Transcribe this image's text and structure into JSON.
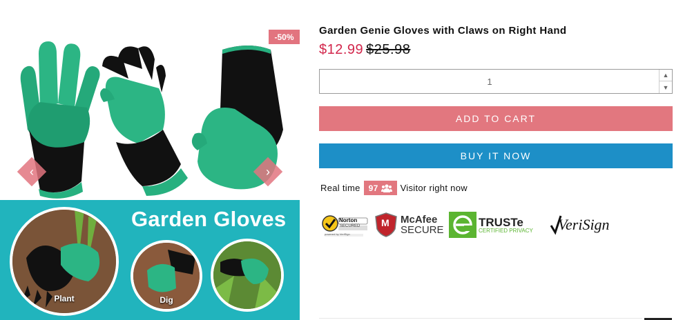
{
  "product": {
    "title": "Garden Genie Gloves with Claws on Right Hand",
    "sale_price": "$12.99",
    "compare_price": "$25.98",
    "discount_badge": "-50%"
  },
  "gallery": {
    "prev_label": "‹",
    "next_label": "›",
    "banner": {
      "title": "Garden Gloves",
      "captions": [
        "Plant",
        "Dig"
      ]
    }
  },
  "quantity": {
    "value": "1",
    "up_label": "▲",
    "down_label": "▼"
  },
  "buttons": {
    "add_to_cart": "ADD TO CART",
    "buy_now": "BUY IT NOW"
  },
  "realtime": {
    "prefix": "Real time",
    "count": "97",
    "suffix": "Visitor right now",
    "icon": "users-icon"
  },
  "trust_badges": {
    "norton": {
      "name": "Norton",
      "sub": "SECURED",
      "powered": "powered by VeriSign"
    },
    "mcafee": {
      "name": "McAfee",
      "sub": "SECURE",
      "mark": "M"
    },
    "truste": {
      "name": "TRUSTe",
      "sub": "CERTIFIED PRIVACY"
    },
    "verisign": {
      "name": "VeriSign"
    }
  },
  "colors": {
    "accent_pink": "#e2777f",
    "price_red": "#d2264b",
    "buy_blue": "#1d8fc7",
    "banner_teal": "#21b4bd",
    "glove_green": "#2fbf8a"
  }
}
